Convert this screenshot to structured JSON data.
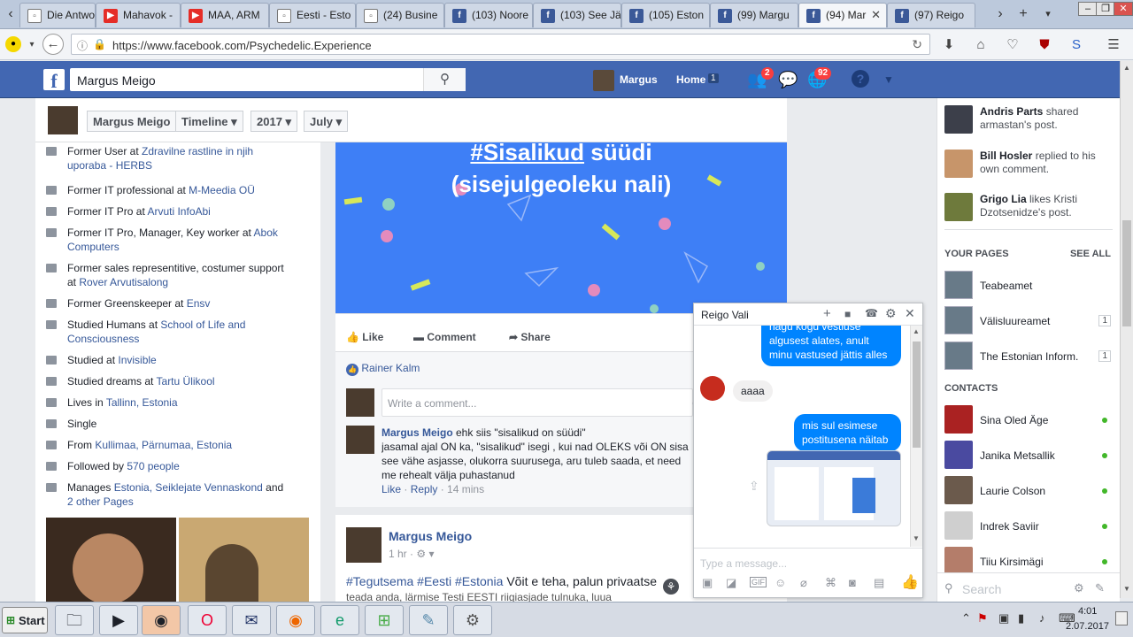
{
  "browser": {
    "tabs": [
      {
        "label": "Die Antwo",
        "icon": "generic-page-icon"
      },
      {
        "label": "Mahavok -",
        "icon": "youtube-icon"
      },
      {
        "label": "MAA, ARM",
        "icon": "youtube-icon"
      },
      {
        "label": "Eesti - Esto",
        "icon": "generic-page-icon"
      },
      {
        "label": "(24) Busine",
        "icon": "generic-page-icon"
      },
      {
        "label": "(103) Noore",
        "icon": "facebook-icon"
      },
      {
        "label": "(103) See Jä",
        "icon": "facebook-icon"
      },
      {
        "label": "(105) Eston",
        "icon": "facebook-icon"
      },
      {
        "label": "(99) Margu",
        "icon": "facebook-icon"
      },
      {
        "label": "(94) Mar",
        "icon": "facebook-icon"
      },
      {
        "label": "(97) Reigo",
        "icon": "facebook-icon"
      }
    ],
    "url": "https://www.facebook.com/Psychedelic.Experience"
  },
  "fb": {
    "search_value": "Margus Meigo",
    "user_name": "Margus",
    "home_label": "Home",
    "home_count": "1",
    "friends_badge": "2",
    "notif_badge": "92"
  },
  "timeline_nav": {
    "name": "Margus Meigo",
    "timeline": "Timeline",
    "year": "2017",
    "month": "July"
  },
  "intro": [
    {
      "pre": "Former User at ",
      "link": "Zdravilne rastline in njih uporaba - HERBS"
    },
    {
      "pre": "Former IT professional at ",
      "link": "M-Meedia OÜ"
    },
    {
      "pre": "Former IT Pro at ",
      "link": "Arvuti InfoAbi"
    },
    {
      "pre": "Former IT Pro, Manager, Key worker at ",
      "link": "Abok Computers"
    },
    {
      "pre": "Former sales representitive, costumer support at ",
      "link": "Rover Arvutisalong"
    },
    {
      "pre": "Former Greenskeeper at ",
      "link": "Ensv"
    },
    {
      "pre": "Studied Humans at ",
      "link": "School of Life and Consciousness"
    },
    {
      "pre": "Studied at ",
      "link": "Invisible"
    },
    {
      "pre": "Studied dreams at ",
      "link": "Tartu Ülikool"
    },
    {
      "pre": "Lives in ",
      "link": "Tallinn, Estonia"
    },
    {
      "pre": "Single",
      "link": ""
    },
    {
      "pre": "From ",
      "link": "Kullimaa, Pärnumaa, Estonia"
    },
    {
      "pre": "Followed by ",
      "link": "570 people"
    },
    {
      "pre": "Manages ",
      "link": "Estonia, Seiklejate Vennaskond"
    }
  ],
  "intro_manages_tail": {
    "and": " and ",
    "link": "2 other Pages"
  },
  "post1": {
    "banner_hashtag": "#Sisalikud",
    "banner_line1_rest": " süüdi",
    "banner_line2": "(sisejulgeoleku nali)",
    "like": "Like",
    "comment": "Comment",
    "share": "Share",
    "liker": "Rainer Kalm",
    "comment_placeholder": "Write a comment...",
    "comment_author": "Margus Meigo",
    "comment_line1": " ehk siis \"sisalikud on süüdi\"",
    "comment_line2": "jasamal ajal ON ka, \"sisalikud\" isegi , kui nad OLEKS või ON sisa",
    "comment_line3": "see vähe asjasse, olukorra suurusega, aru tuleb saada, et need",
    "comment_line4": "me rehealt välja puhastanud",
    "comment_like": "Like",
    "comment_reply": "Reply",
    "comment_time": "14 mins"
  },
  "post2": {
    "author": "Margus Meigo",
    "time": "1 hr",
    "hashtags": "#Tegutsema #Eesti #Estonia",
    "text": " Võit e teha, palun privaatse",
    "text2": "teada anda, lärmise Testi EESTI riigiasjade tulnuka, luua"
  },
  "chat": {
    "title": "Reigo Vali",
    "msg1": "nagu kogu vestluse algusest alates, anult minu vastused jättis alles",
    "msg2": "aaaa",
    "msg3": "mis sul esimese postitusena näitab",
    "input_placeholder": "Type a message..."
  },
  "ticker": [
    {
      "name": "Andris Parts",
      "rest": " shared armastan's post."
    },
    {
      "name": "Bill Hosler",
      "rest": " replied to his own comment."
    },
    {
      "name": "Grigo Lia",
      "rest": " likes Kristi Dzotsenidze's post."
    }
  ],
  "your_pages": {
    "heading": "YOUR PAGES",
    "see_all": "SEE ALL",
    "items": [
      {
        "name": "Teabeamet",
        "count": ""
      },
      {
        "name": "Välisluureamet",
        "count": "1"
      },
      {
        "name": "The Estonian Inform...",
        "count": "1"
      }
    ]
  },
  "contacts": {
    "heading": "CONTACTS",
    "items": [
      "Sina Oled Äge",
      "Janika Metsallik",
      "Laurie Colson",
      "Indrek Saviir",
      "Tiiu Kirsimägi"
    ],
    "search_placeholder": "Search"
  },
  "taskbar": {
    "start": "Start",
    "time": "4:01",
    "date": "2.07.2017"
  },
  "colors": {
    "fb_blue": "#4267b2",
    "banner_blue": "#3e7ff6",
    "messenger_blue": "#0084ff",
    "link": "#365899",
    "online_green": "#42b72a"
  }
}
